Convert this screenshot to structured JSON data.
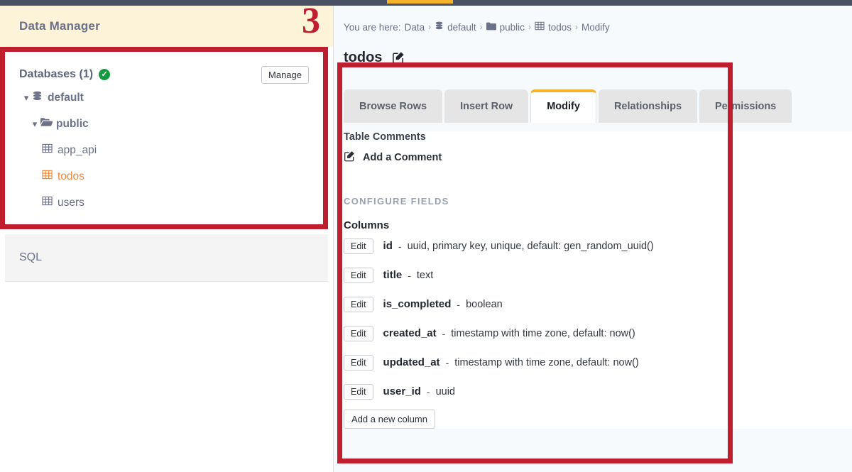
{
  "topbar": {
    "active_tab_indicator": "data-tab-indicator",
    "accent": "#f5b32d",
    "background": "#4a5164"
  },
  "annotation": {
    "color": "#be1e2d",
    "step_number": "3"
  },
  "sidebar": {
    "title": "Data Manager",
    "databases": {
      "heading": "Databases (1)",
      "status_icon": "check-circle-icon",
      "manage_label": "Manage"
    },
    "tree": [
      {
        "level": 1,
        "label": "default",
        "icon": "database-icon",
        "chevron": "chevron-down-icon",
        "active": false
      },
      {
        "level": 2,
        "label": "public",
        "icon": "folder-open-icon",
        "chevron": "chevron-down-icon",
        "active": false
      },
      {
        "level": 3,
        "label": "app_api",
        "icon": "table-icon",
        "active": false
      },
      {
        "level": 3,
        "label": "todos",
        "icon": "table-icon",
        "active": true
      },
      {
        "level": 3,
        "label": "users",
        "icon": "table-icon",
        "active": false
      }
    ],
    "sql_label": "SQL",
    "active_table_color": "#f0883e"
  },
  "main": {
    "breadcrumb": {
      "prefix": "You are here:",
      "items": [
        {
          "label": "Data",
          "icon": ""
        },
        {
          "label": "default",
          "icon": "database-icon"
        },
        {
          "label": "public",
          "icon": "folder-icon"
        },
        {
          "label": "todos",
          "icon": "table-icon"
        },
        {
          "label": "Modify",
          "icon": ""
        }
      ],
      "separator": "›"
    },
    "page_title": "todos",
    "page_title_edit_icon": "edit-pencil-icon",
    "tabs": [
      {
        "label": "Browse Rows",
        "active": false
      },
      {
        "label": "Insert Row",
        "active": false
      },
      {
        "label": "Modify",
        "active": true
      },
      {
        "label": "Relationships",
        "active": false
      },
      {
        "label": "Permissions",
        "active": false
      }
    ],
    "table_comments": {
      "heading": "Table Comments",
      "add_label": "Add a Comment",
      "add_icon": "edit-pencil-icon"
    },
    "configure_fields_label": "CONFIGURE FIELDS",
    "columns_label": "Columns",
    "edit_button_label": "Edit",
    "dash": "-",
    "columns": [
      {
        "name": "id",
        "type": "uuid, primary key, unique, default: gen_random_uuid()"
      },
      {
        "name": "title",
        "type": "text"
      },
      {
        "name": "is_completed",
        "type": "boolean"
      },
      {
        "name": "created_at",
        "type": "timestamp with time zone, default: now()"
      },
      {
        "name": "updated_at",
        "type": "timestamp with time zone, default: now()"
      },
      {
        "name": "user_id",
        "type": "uuid"
      }
    ],
    "add_column_label": "Add a new column"
  }
}
